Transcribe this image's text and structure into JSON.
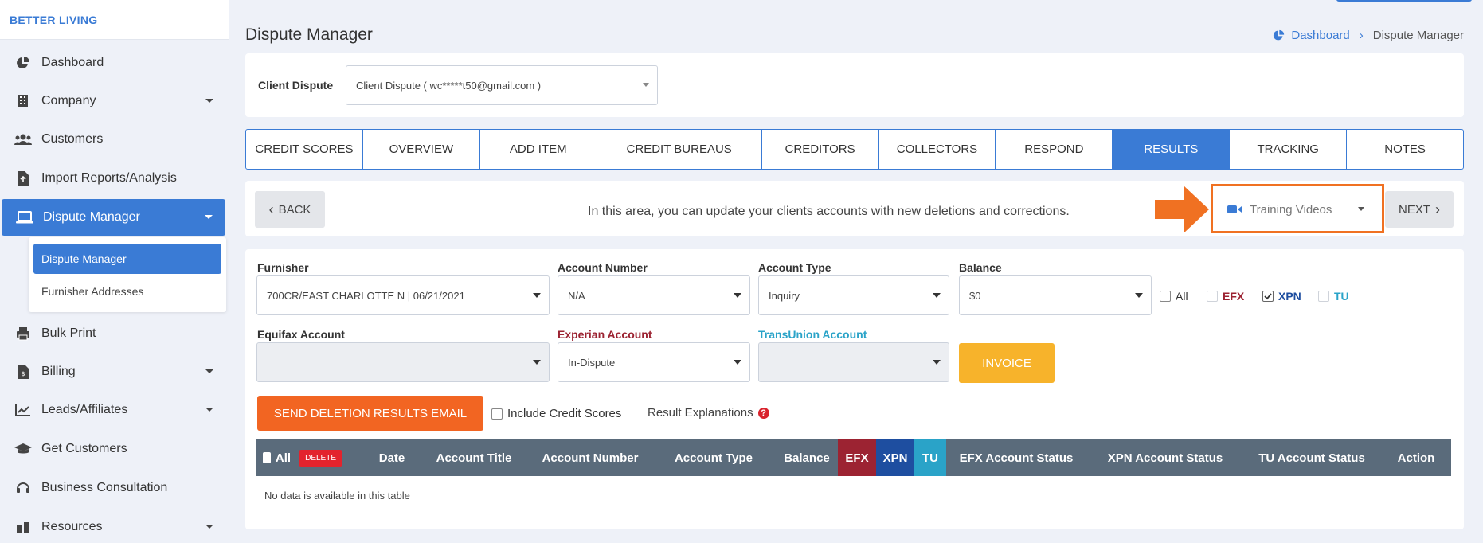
{
  "brand": "BETTER LIVING",
  "sidebar": {
    "items": [
      {
        "label": "Dashboard",
        "icon": "pie-chart-icon"
      },
      {
        "label": "Company",
        "icon": "building-icon"
      },
      {
        "label": "Customers",
        "icon": "users-icon"
      },
      {
        "label": "Import Reports/Analysis",
        "icon": "file-import-icon"
      },
      {
        "label": "Dispute Manager",
        "icon": "laptop-icon"
      },
      {
        "label": "Bulk Print",
        "icon": "printer-icon"
      },
      {
        "label": "Billing",
        "icon": "invoice-icon"
      },
      {
        "label": "Leads/Affiliates",
        "icon": "chart-line-icon"
      },
      {
        "label": "Get Customers",
        "icon": "graduation-cap-icon"
      },
      {
        "label": "Business Consultation",
        "icon": "headset-icon"
      },
      {
        "label": "Resources",
        "icon": "box-icon"
      }
    ],
    "submenu": [
      "Dispute Manager",
      "Furnisher Addresses"
    ]
  },
  "header": {
    "title": "Dispute Manager",
    "breadcrumb": {
      "home": "Dashboard",
      "current": "Dispute Manager"
    }
  },
  "client": {
    "label": "Client Dispute",
    "value": "Client Dispute ( wc*****t50@gmail.com )"
  },
  "tabs": [
    {
      "label": "CREDIT SCORES"
    },
    {
      "label": "OVERVIEW"
    },
    {
      "label": "ADD ITEM"
    },
    {
      "label": "CREDIT BUREAUS"
    },
    {
      "label": "CREDITORS"
    },
    {
      "label": "COLLECTORS"
    },
    {
      "label": "RESPOND"
    },
    {
      "label": "RESULTS"
    },
    {
      "label": "TRACKING"
    },
    {
      "label": "NOTES"
    }
  ],
  "actions": {
    "back": "BACK",
    "info": "In this area, you can update your clients accounts with new deletions and corrections.",
    "training": "Training Videos",
    "next": "NEXT"
  },
  "form": {
    "furnisher": {
      "label": "Furnisher",
      "value": "700CR/EAST CHARLOTTE N | 06/21/2021"
    },
    "account_number": {
      "label": "Account Number",
      "value": "N/A"
    },
    "account_type": {
      "label": "Account Type",
      "value": "Inquiry"
    },
    "balance": {
      "label": "Balance",
      "value": "$0"
    },
    "bureaus": {
      "all": "All",
      "efx": "EFX",
      "xpn": "XPN",
      "tu": "TU"
    },
    "equifax": {
      "label": "Equifax Account",
      "value": ""
    },
    "experian": {
      "label": "Experian Account",
      "value": "In-Dispute"
    },
    "transunion": {
      "label": "TransUnion Account",
      "value": ""
    },
    "invoice": "INVOICE",
    "send_email": "SEND DELETION RESULTS EMAIL",
    "include_scores": "Include Credit Scores",
    "explanations": "Result Explanations"
  },
  "table": {
    "all": "All",
    "delete": "DELETE",
    "columns": [
      "Date",
      "Account Title",
      "Account Number",
      "Account Type",
      "Balance",
      "EFX",
      "XPN",
      "TU",
      "EFX Account Status",
      "XPN Account Status",
      "TU Account Status",
      "Action"
    ],
    "empty": "No data is available in this table"
  },
  "colors": {
    "primary": "#3a7bd5",
    "orange": "#f26522",
    "yellow": "#f7b32b",
    "efx": "#9c2332",
    "xpn": "#1e4ea0",
    "tu": "#2aa3c8"
  }
}
